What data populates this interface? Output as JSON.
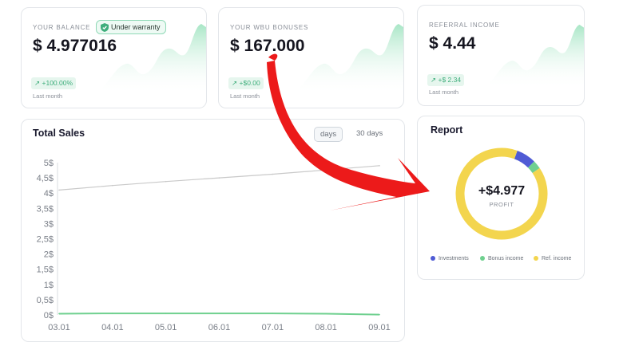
{
  "balance_card": {
    "label": "YOUR BALANCE",
    "badge": "Under warranty",
    "value": "$ 4.977016",
    "change": "+100.00%",
    "period": "Last month"
  },
  "bonuses_card": {
    "label": "YOUR WBU BONUSES",
    "value": "$ 167.000",
    "change": "+$0.00",
    "period": "Last month"
  },
  "referral_card": {
    "label": "REFERRAL INCOME",
    "value": "$ 4.44",
    "change": "+$ 2.34",
    "period": "Last month"
  },
  "sales": {
    "title": "Total Sales",
    "range_tabs": [
      "days",
      "30 days"
    ],
    "active_tab": 0
  },
  "report": {
    "title": "Report",
    "total": "+$4.977",
    "total_label": "PROFIT",
    "legend": [
      {
        "label": "Investments",
        "color": "#4f5bd5"
      },
      {
        "label": "Bonus income",
        "color": "#6fd08f"
      },
      {
        "label": "Ref. income",
        "color": "#f3d54e"
      }
    ]
  },
  "chart_data": [
    {
      "type": "line",
      "x": [
        "03.01",
        "04.01",
        "05.01",
        "06.01",
        "07.01",
        "08.01",
        "09.01"
      ],
      "y_ticks": [
        "0$",
        "0,5$",
        "1$",
        "1,5$",
        "2$",
        "2,5$",
        "3$",
        "3,5$",
        "4$",
        "4,5$",
        "5$"
      ],
      "ylim": [
        0,
        5
      ],
      "series": [
        {
          "values": [
            4.1,
            4.25,
            4.38,
            4.5,
            4.62,
            4.76,
            4.9
          ],
          "color": "#c9c9c9"
        },
        {
          "values": [
            0.04,
            0.05,
            0.05,
            0.05,
            0.05,
            0.04,
            0.01
          ],
          "color": "#6fd08f"
        }
      ]
    },
    {
      "type": "pie",
      "labels": [
        "Investments",
        "Bonus income",
        "Ref. income"
      ],
      "values": [
        7,
        3,
        90
      ],
      "colors": [
        "#4f5bd5",
        "#6fd08f",
        "#f3d54e"
      ]
    }
  ],
  "colors": {
    "accent_green": "#6fd08f",
    "arrow_red": "#ec1a1a"
  }
}
